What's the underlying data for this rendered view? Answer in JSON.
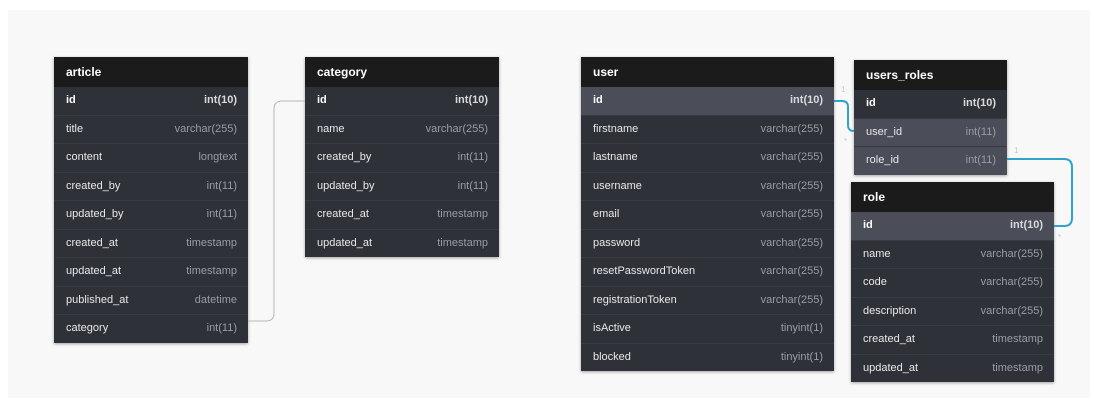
{
  "tables": {
    "article": {
      "name": "article",
      "fields": [
        {
          "name": "id",
          "type": "int(10)"
        },
        {
          "name": "title",
          "type": "varchar(255)"
        },
        {
          "name": "content",
          "type": "longtext"
        },
        {
          "name": "created_by",
          "type": "int(11)"
        },
        {
          "name": "updated_by",
          "type": "int(11)"
        },
        {
          "name": "created_at",
          "type": "timestamp"
        },
        {
          "name": "updated_at",
          "type": "timestamp"
        },
        {
          "name": "published_at",
          "type": "datetime"
        },
        {
          "name": "category",
          "type": "int(11)"
        }
      ]
    },
    "category": {
      "name": "category",
      "fields": [
        {
          "name": "id",
          "type": "int(10)"
        },
        {
          "name": "name",
          "type": "varchar(255)"
        },
        {
          "name": "created_by",
          "type": "int(11)"
        },
        {
          "name": "updated_by",
          "type": "int(11)"
        },
        {
          "name": "created_at",
          "type": "timestamp"
        },
        {
          "name": "updated_at",
          "type": "timestamp"
        }
      ]
    },
    "user": {
      "name": "user",
      "fields": [
        {
          "name": "id",
          "type": "int(10)"
        },
        {
          "name": "firstname",
          "type": "varchar(255)"
        },
        {
          "name": "lastname",
          "type": "varchar(255)"
        },
        {
          "name": "username",
          "type": "varchar(255)"
        },
        {
          "name": "email",
          "type": "varchar(255)"
        },
        {
          "name": "password",
          "type": "varchar(255)"
        },
        {
          "name": "resetPasswordToken",
          "type": "varchar(255)"
        },
        {
          "name": "registrationToken",
          "type": "varchar(255)"
        },
        {
          "name": "isActive",
          "type": "tinyint(1)"
        },
        {
          "name": "blocked",
          "type": "tinyint(1)"
        }
      ]
    },
    "users_roles": {
      "name": "users_roles",
      "fields": [
        {
          "name": "id",
          "type": "int(10)"
        },
        {
          "name": "user_id",
          "type": "int(11)"
        },
        {
          "name": "role_id",
          "type": "int(11)"
        }
      ]
    },
    "role": {
      "name": "role",
      "fields": [
        {
          "name": "id",
          "type": "int(10)"
        },
        {
          "name": "name",
          "type": "varchar(255)"
        },
        {
          "name": "code",
          "type": "varchar(255)"
        },
        {
          "name": "description",
          "type": "varchar(255)"
        },
        {
          "name": "created_at",
          "type": "timestamp"
        },
        {
          "name": "updated_at",
          "type": "timestamp"
        }
      ]
    }
  },
  "relations": [
    {
      "from": "article.category",
      "to": "category.id",
      "highlighted": false
    },
    {
      "from": "user.id",
      "to": "users_roles.user_id",
      "highlighted": true,
      "from_card": "1",
      "to_card": "*"
    },
    {
      "from": "users_roles.role_id",
      "to": "role.id",
      "highlighted": true,
      "from_card": "1",
      "to_card": "*"
    }
  ],
  "colors": {
    "header_bg": "#1b1b1c",
    "body_bg": "#2f3138",
    "highlight_row": "#4b4e58",
    "link_highlight": "#2fa3c9",
    "link_normal": "#b8b8b8"
  }
}
